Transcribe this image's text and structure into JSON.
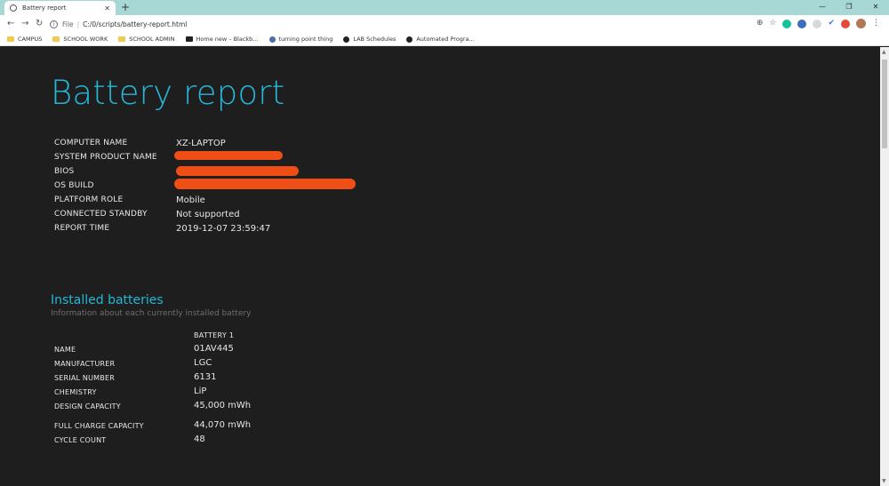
{
  "browser": {
    "tab_title": "Battery report",
    "tab_close": "✕",
    "new_tab": "+",
    "window_controls": [
      "—",
      "❐",
      "✕"
    ],
    "url_scheme": "File",
    "url_path": "C:/0/scripts/battery-report.html",
    "bookmarks": [
      {
        "label": "CAMPUS",
        "icon": "folder-icon"
      },
      {
        "label": "SCHOOL WORK",
        "icon": "folder-icon"
      },
      {
        "label": "SCHOOL ADMIN",
        "icon": "folder-icon"
      },
      {
        "label": "Home new – Blackb...",
        "icon": "blackboard-icon"
      },
      {
        "label": "turning point thing",
        "icon": "turning-point-icon"
      },
      {
        "label": "LAB Schedules",
        "icon": "lab-icon"
      },
      {
        "label": "Automated Progra...",
        "icon": "automation-icon"
      }
    ],
    "colors": {
      "tabstrip": "#a8d8d6",
      "accent": "#27b7d6",
      "redaction": "#f04e17"
    }
  },
  "report": {
    "title": "Battery report",
    "system": [
      {
        "key": "COMPUTER NAME",
        "value": "XZ-LAPTOP"
      },
      {
        "key": "SYSTEM PRODUCT NAME",
        "value": ""
      },
      {
        "key": "BIOS",
        "value": ""
      },
      {
        "key": "OS BUILD",
        "value": ""
      },
      {
        "key": "PLATFORM ROLE",
        "value": "Mobile"
      },
      {
        "key": "CONNECTED STANDBY",
        "value": "Not supported"
      },
      {
        "key": "REPORT TIME",
        "value": "2019-12-07   23:59:47"
      }
    ],
    "installed": {
      "title": "Installed batteries",
      "subtitle": "Information about each currently installed battery",
      "column": "BATTERY 1",
      "rows": [
        {
          "key": "NAME",
          "value": "01AV445"
        },
        {
          "key": "MANUFACTURER",
          "value": "LGC"
        },
        {
          "key": "SERIAL NUMBER",
          "value": "6131"
        },
        {
          "key": "CHEMISTRY",
          "value": "LiP"
        },
        {
          "key": "DESIGN CAPACITY",
          "value": "45,000 mWh"
        },
        {
          "key": "FULL CHARGE CAPACITY",
          "value": "44,070 mWh"
        },
        {
          "key": "CYCLE COUNT",
          "value": "48"
        }
      ]
    }
  }
}
